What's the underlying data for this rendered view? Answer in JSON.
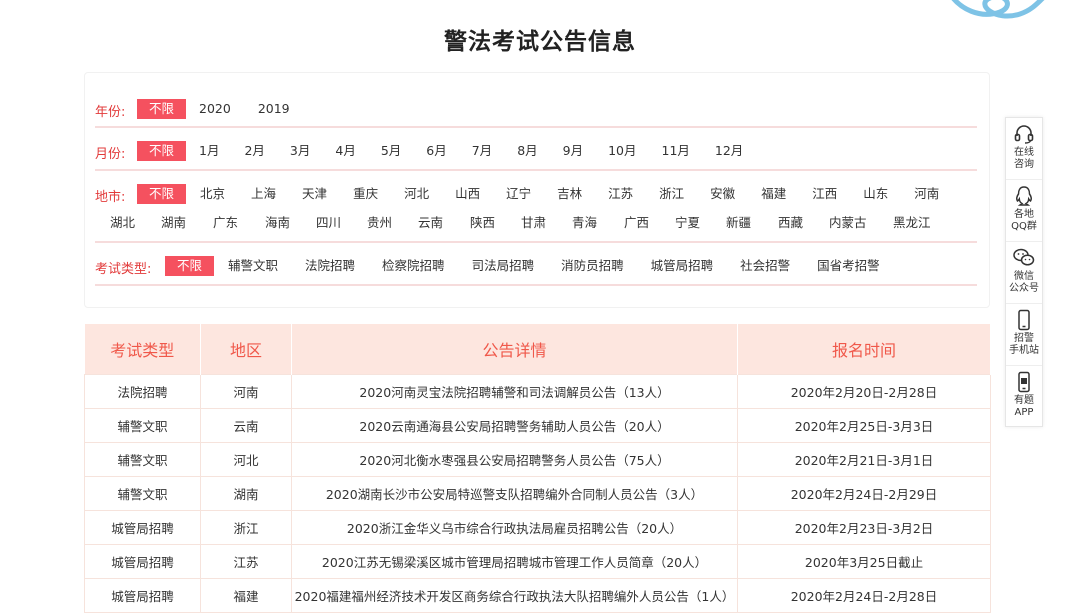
{
  "title": "警法考试公告信息",
  "filters": {
    "year": {
      "label": "年份:",
      "options": [
        "不限",
        "2020",
        "2019"
      ]
    },
    "month": {
      "label": "月份:",
      "options": [
        "不限",
        "1月",
        "2月",
        "3月",
        "4月",
        "5月",
        "6月",
        "7月",
        "8月",
        "9月",
        "10月",
        "11月",
        "12月"
      ]
    },
    "region": {
      "label": "地市:",
      "options": [
        "不限",
        "北京",
        "上海",
        "天津",
        "重庆",
        "河北",
        "山西",
        "辽宁",
        "吉林",
        "江苏",
        "浙江",
        "安徽",
        "福建",
        "江西",
        "山东",
        "河南"
      ],
      "options2": [
        "湖北",
        "湖南",
        "广东",
        "海南",
        "四川",
        "贵州",
        "云南",
        "陕西",
        "甘肃",
        "青海",
        "广西",
        "宁夏",
        "新疆",
        "西藏",
        "内蒙古",
        "黑龙江"
      ]
    },
    "type": {
      "label": "考试类型:",
      "options": [
        "不限",
        "辅警文职",
        "法院招聘",
        "检察院招聘",
        "司法局招聘",
        "消防员招聘",
        "城管局招聘",
        "社会招警",
        "国省考招警"
      ]
    }
  },
  "table": {
    "headers": [
      "考试类型",
      "地区",
      "公告详情",
      "报名时间"
    ],
    "rows": [
      [
        "法院招聘",
        "河南",
        "2020河南灵宝法院招聘辅警和司法调解员公告（13人）",
        "2020年2月20日-2月28日"
      ],
      [
        "辅警文职",
        "云南",
        "2020云南通海县公安局招聘警务辅助人员公告（20人）",
        "2020年2月25日-3月3日"
      ],
      [
        "辅警文职",
        "河北",
        "2020河北衡水枣强县公安局招聘警务人员公告（75人）",
        "2020年2月21日-3月1日"
      ],
      [
        "辅警文职",
        "湖南",
        "2020湖南长沙市公安局特巡警支队招聘编外合同制人员公告（3人）",
        "2020年2月24日-2月29日"
      ],
      [
        "城管局招聘",
        "浙江",
        "2020浙江金华义乌市综合行政执法局雇员招聘公告（20人）",
        "2020年2月23日-3月2日"
      ],
      [
        "城管局招聘",
        "江苏",
        "2020江苏无锡梁溪区城市管理局招聘城市管理工作人员简章（20人）",
        "2020年3月25日截止"
      ],
      [
        "城管局招聘",
        "福建",
        "2020福建福州经济技术开发区商务综合行政执法大队招聘编外人员公告（1人）",
        "2020年2月24日-2月28日"
      ]
    ]
  },
  "sidebar": {
    "consult": [
      "在线",
      "咨询"
    ],
    "qq": [
      "各地",
      "QQ群"
    ],
    "wechat": [
      "微信",
      "公众号"
    ],
    "mobile": [
      "招警",
      "手机站"
    ],
    "app": [
      "有题",
      "APP"
    ]
  },
  "colors": {
    "accent": "#f5515f",
    "header_bg": "#fde6df",
    "header_text": "#f0584a",
    "label": "#e23b3b"
  }
}
